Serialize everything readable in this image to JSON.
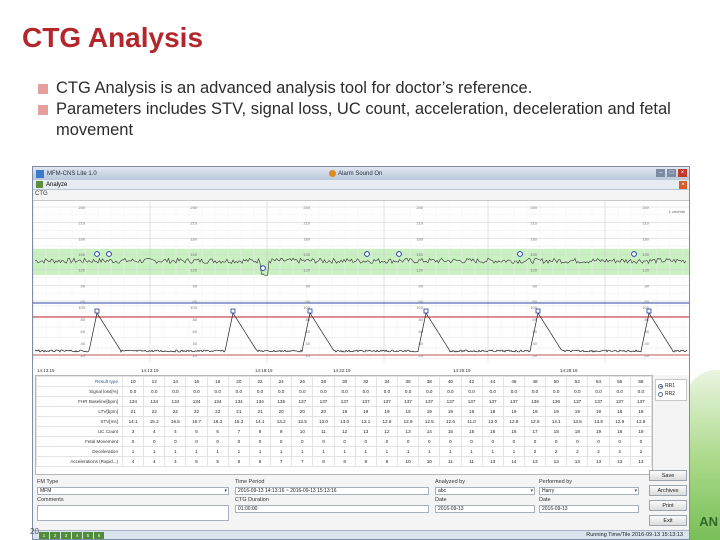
{
  "slide": {
    "title": "CTG Analysis",
    "bullets": [
      "CTG Analysis is an advanced analysis tool for doctor’s reference.",
      "Parameters includes STV, signal loss, UC count, acceleration, deceleration and fetal movement"
    ],
    "slide_number": "20",
    "deco_text": "AN",
    "bullet_color": "#e5a09d",
    "title_color": "#b3262b"
  },
  "window": {
    "title": "MFM-CNS Lite 1.0",
    "alarm_text": "Alarm Sound On",
    "tab_label": "Analyze",
    "panel_label": "CTG",
    "ctg_time_labels": [
      "14:13:15",
      "14:13:19",
      "14:19:19",
      "14:22:19",
      "14:25:19",
      "14:28:19"
    ],
    "ctg_fhr_ticks": [
      "240",
      "210",
      "180",
      "150",
      "120",
      "90",
      "60"
    ],
    "ctg_uc_ticks": [
      "100",
      "80",
      "60",
      "40",
      "20"
    ],
    "ctg_unit_label": "1 cm/min"
  },
  "results": {
    "row_headers": [
      "Result type",
      "Signal loss[%]",
      "FHR Baseline[bpm]",
      "LTV[bpm]",
      "STV[ms]",
      "UC Count",
      "Fetal Movement",
      "Deceleration",
      "Accelerations (Rapid...)"
    ],
    "rows": [
      [
        "10",
        "12",
        "14",
        "16",
        "18",
        "20",
        "22",
        "24",
        "26",
        "28",
        "30",
        "32",
        "34",
        "36",
        "38",
        "40",
        "42",
        "44",
        "46",
        "48",
        "50",
        "52",
        "54",
        "56",
        "58"
      ],
      [
        "0.0",
        "0.0",
        "0.0",
        "0.0",
        "0.0",
        "0.0",
        "0.0",
        "0.0",
        "0.0",
        "0.0",
        "0.0",
        "0.0",
        "0.0",
        "0.0",
        "0.0",
        "0.0",
        "0.0",
        "0.0",
        "0.0",
        "0.0",
        "0.0",
        "0.0",
        "0.0",
        "0.0",
        "0.0"
      ],
      [
        "134",
        "134",
        "134",
        "134",
        "134",
        "134",
        "134",
        "135",
        "137",
        "137",
        "137",
        "137",
        "137",
        "137",
        "137",
        "137",
        "137",
        "137",
        "137",
        "136",
        "136",
        "137",
        "137",
        "137",
        "137"
      ],
      [
        "21",
        "22",
        "22",
        "22",
        "22",
        "21",
        "21",
        "20",
        "20",
        "20",
        "19",
        "19",
        "19",
        "19",
        "19",
        "19",
        "19",
        "18",
        "19",
        "19",
        "19",
        "19",
        "19",
        "18",
        "18"
      ],
      [
        "14.1",
        "15.2",
        "16.5",
        "16.7",
        "16.3",
        "15.3",
        "14.1",
        "13.2",
        "13.5",
        "13.0",
        "13.0",
        "13.1",
        "12.8",
        "12.9",
        "12.5",
        "12.6",
        "11.0",
        "13.0",
        "12.9",
        "12.6",
        "13.1",
        "13.5",
        "13.6",
        "12.9",
        "12.8"
      ],
      [
        "3",
        "4",
        "4",
        "5",
        "6",
        "7",
        "8",
        "9",
        "10",
        "11",
        "12",
        "13",
        "12",
        "13",
        "14",
        "15",
        "15",
        "16",
        "16",
        "17",
        "18",
        "18",
        "19",
        "18",
        "19"
      ],
      [
        "0",
        "0",
        "0",
        "0",
        "0",
        "0",
        "0",
        "0",
        "0",
        "0",
        "0",
        "0",
        "0",
        "0",
        "0",
        "0",
        "0",
        "0",
        "0",
        "0",
        "0",
        "0",
        "0",
        "0",
        "0"
      ],
      [
        "1",
        "1",
        "1",
        "1",
        "1",
        "1",
        "1",
        "1",
        "1",
        "1",
        "1",
        "1",
        "1",
        "1",
        "1",
        "1",
        "1",
        "1",
        "1",
        "2",
        "2",
        "2",
        "2",
        "2",
        "2"
      ],
      [
        "4",
        "4",
        "4",
        "5",
        "5",
        "6",
        "6",
        "7",
        "7",
        "8",
        "8",
        "8",
        "9",
        "10",
        "10",
        "11",
        "11",
        "13",
        "14",
        "13",
        "13",
        "13",
        "13",
        "13",
        "13"
      ]
    ],
    "radio_options": [
      "RR1",
      "RR2"
    ],
    "radio_selected": 0
  },
  "form": {
    "fm_type_label": "FM Type",
    "fm_type_value": "MFM",
    "time_period_label": "Time Period",
    "time_period_value": "2016-09-13 14:13:16 ~ 2016-09-13 15:13:16",
    "analyzed_by_label": "Analyzed by",
    "analyzed_by_value": "abc",
    "performed_by_label": "Performed by",
    "performed_by_value": "Harry",
    "comments_label": "Comments",
    "ctg_duration_label": "CTG Duration",
    "ctg_duration_value": "01:00:00",
    "date_label_1": "Date",
    "date_value_1": "2016-09-13",
    "date_label_2": "Date",
    "date_value_2": "2016-09-13",
    "buttons": [
      "Save",
      "Archives",
      "Print",
      "Exit"
    ]
  },
  "statusbar": {
    "pages": [
      "1",
      "2",
      "3",
      "4",
      "5",
      "6"
    ],
    "text": "Running Time/Tile 2016-09-13 15:13:13"
  }
}
